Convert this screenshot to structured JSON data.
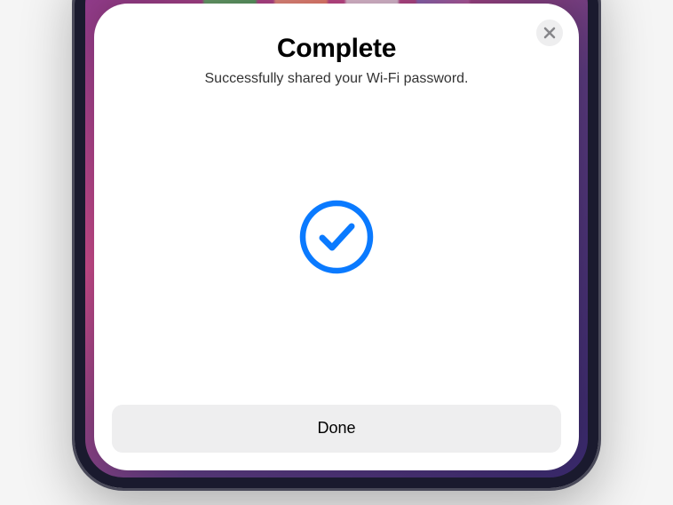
{
  "modal": {
    "title": "Complete",
    "subtitle": "Successfully shared your Wi-Fi password.",
    "done_label": "Done"
  },
  "colors": {
    "accent": "#0a7aff",
    "button_bg": "#eeeeef",
    "close_bg": "#eeeeef"
  }
}
